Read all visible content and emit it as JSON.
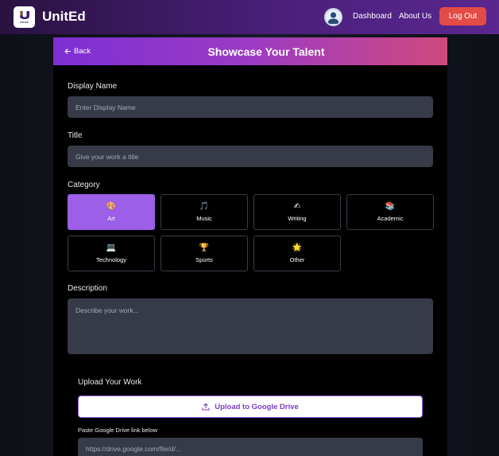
{
  "navbar": {
    "brand": "UnitEd",
    "logo_sub": "UNITED",
    "links": [
      "Dashboard",
      "About Us"
    ],
    "logout_label": "Log Out"
  },
  "header": {
    "back_label": "Back",
    "title": "Showcase Your Talent"
  },
  "form": {
    "display_name": {
      "label": "Display Name",
      "placeholder": "Enter Display Name"
    },
    "title": {
      "label": "Title",
      "placeholder": "Give your work a title"
    },
    "category": {
      "label": "Category",
      "selected": "Art",
      "options": [
        {
          "label": "Art",
          "icon": "🎨"
        },
        {
          "label": "Music",
          "icon": "🎵"
        },
        {
          "label": "Writing",
          "icon": "✍"
        },
        {
          "label": "Academic",
          "icon": "📚"
        },
        {
          "label": "Technology",
          "icon": "💻"
        },
        {
          "label": "Sports",
          "icon": "🏆"
        },
        {
          "label": "Other",
          "icon": "🌟"
        }
      ]
    },
    "description": {
      "label": "Description",
      "placeholder": "Describe your work..."
    },
    "upload": {
      "section_label": "Upload Your Work",
      "button_label": "Upload to Google Drive",
      "link_label": "Paste Google Drive link below",
      "link_placeholder": "https://drive.google.com/file/d/..."
    }
  },
  "colors": {
    "accent": "#9c5fe8",
    "logout": "#e34b47",
    "input_bg": "#373b48"
  }
}
